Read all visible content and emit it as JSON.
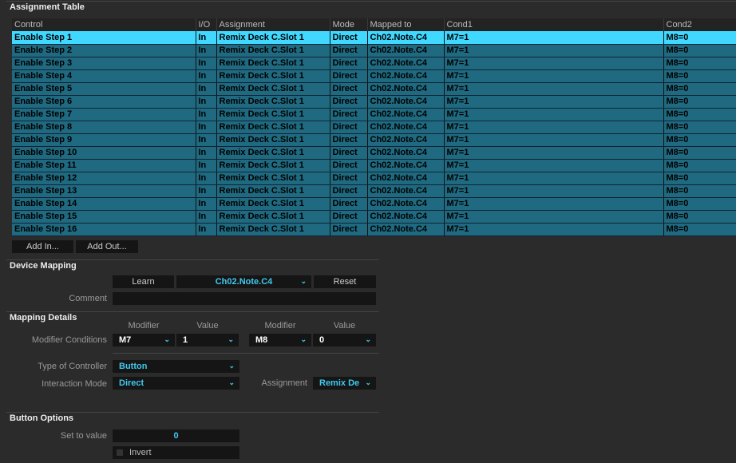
{
  "assignment_table": {
    "title": "Assignment Table",
    "columns": [
      "Control",
      "I/O",
      "Assignment",
      "Mode",
      "Mapped to",
      "Cond1",
      "Cond2"
    ],
    "rows": [
      [
        "Enable Step 1",
        "In",
        "Remix Deck C.Slot 1",
        "Direct",
        "Ch02.Note.C4",
        "M7=1",
        "M8=0"
      ],
      [
        "Enable Step 2",
        "In",
        "Remix Deck C.Slot 1",
        "Direct",
        "Ch02.Note.C4",
        "M7=1",
        "M8=0"
      ],
      [
        "Enable Step 3",
        "In",
        "Remix Deck C.Slot 1",
        "Direct",
        "Ch02.Note.C4",
        "M7=1",
        "M8=0"
      ],
      [
        "Enable Step 4",
        "In",
        "Remix Deck C.Slot 1",
        "Direct",
        "Ch02.Note.C4",
        "M7=1",
        "M8=0"
      ],
      [
        "Enable Step 5",
        "In",
        "Remix Deck C.Slot 1",
        "Direct",
        "Ch02.Note.C4",
        "M7=1",
        "M8=0"
      ],
      [
        "Enable Step 6",
        "In",
        "Remix Deck C.Slot 1",
        "Direct",
        "Ch02.Note.C4",
        "M7=1",
        "M8=0"
      ],
      [
        "Enable Step 7",
        "In",
        "Remix Deck C.Slot 1",
        "Direct",
        "Ch02.Note.C4",
        "M7=1",
        "M8=0"
      ],
      [
        "Enable Step 8",
        "In",
        "Remix Deck C.Slot 1",
        "Direct",
        "Ch02.Note.C4",
        "M7=1",
        "M8=0"
      ],
      [
        "Enable Step 9",
        "In",
        "Remix Deck C.Slot 1",
        "Direct",
        "Ch02.Note.C4",
        "M7=1",
        "M8=0"
      ],
      [
        "Enable Step 10",
        "In",
        "Remix Deck C.Slot 1",
        "Direct",
        "Ch02.Note.C4",
        "M7=1",
        "M8=0"
      ],
      [
        "Enable Step 11",
        "In",
        "Remix Deck C.Slot 1",
        "Direct",
        "Ch02.Note.C4",
        "M7=1",
        "M8=0"
      ],
      [
        "Enable Step 12",
        "In",
        "Remix Deck C.Slot 1",
        "Direct",
        "Ch02.Note.C4",
        "M7=1",
        "M8=0"
      ],
      [
        "Enable Step 13",
        "In",
        "Remix Deck C.Slot 1",
        "Direct",
        "Ch02.Note.C4",
        "M7=1",
        "M8=0"
      ],
      [
        "Enable Step 14",
        "In",
        "Remix Deck C.Slot 1",
        "Direct",
        "Ch02.Note.C4",
        "M7=1",
        "M8=0"
      ],
      [
        "Enable Step 15",
        "In",
        "Remix Deck C.Slot 1",
        "Direct",
        "Ch02.Note.C4",
        "M7=1",
        "M8=0"
      ],
      [
        "Enable Step 16",
        "In",
        "Remix Deck C.Slot 1",
        "Direct",
        "Ch02.Note.C4",
        "M7=1",
        "M8=0"
      ]
    ],
    "selected_row": 0,
    "add_in": "Add In...",
    "add_out": "Add Out..."
  },
  "device_mapping": {
    "title": "Device Mapping",
    "learn": "Learn",
    "mapped_to": "Ch02.Note.C4",
    "reset": "Reset",
    "comment_label": "Comment",
    "comment_value": ""
  },
  "mapping_details": {
    "title": "Mapping Details",
    "modifier_header": "Modifier",
    "value_header": "Value",
    "modifier_conditions_label": "Modifier Conditions",
    "mod1": "M7",
    "val1": "1",
    "mod2": "M8",
    "val2": "0",
    "type_label": "Type of Controller",
    "type_value": "Button",
    "interaction_label": "Interaction Mode",
    "interaction_value": "Direct",
    "assignment_label": "Assignment",
    "assignment_value": "Remix De"
  },
  "button_options": {
    "title": "Button Options",
    "set_to_value_label": "Set to value",
    "set_to_value": "0",
    "invert_label": "Invert",
    "invert_checked": false
  },
  "colors": {
    "selected_row": "#40d8ff",
    "row": "#1f6a80",
    "accent_text": "#40c8f0"
  }
}
